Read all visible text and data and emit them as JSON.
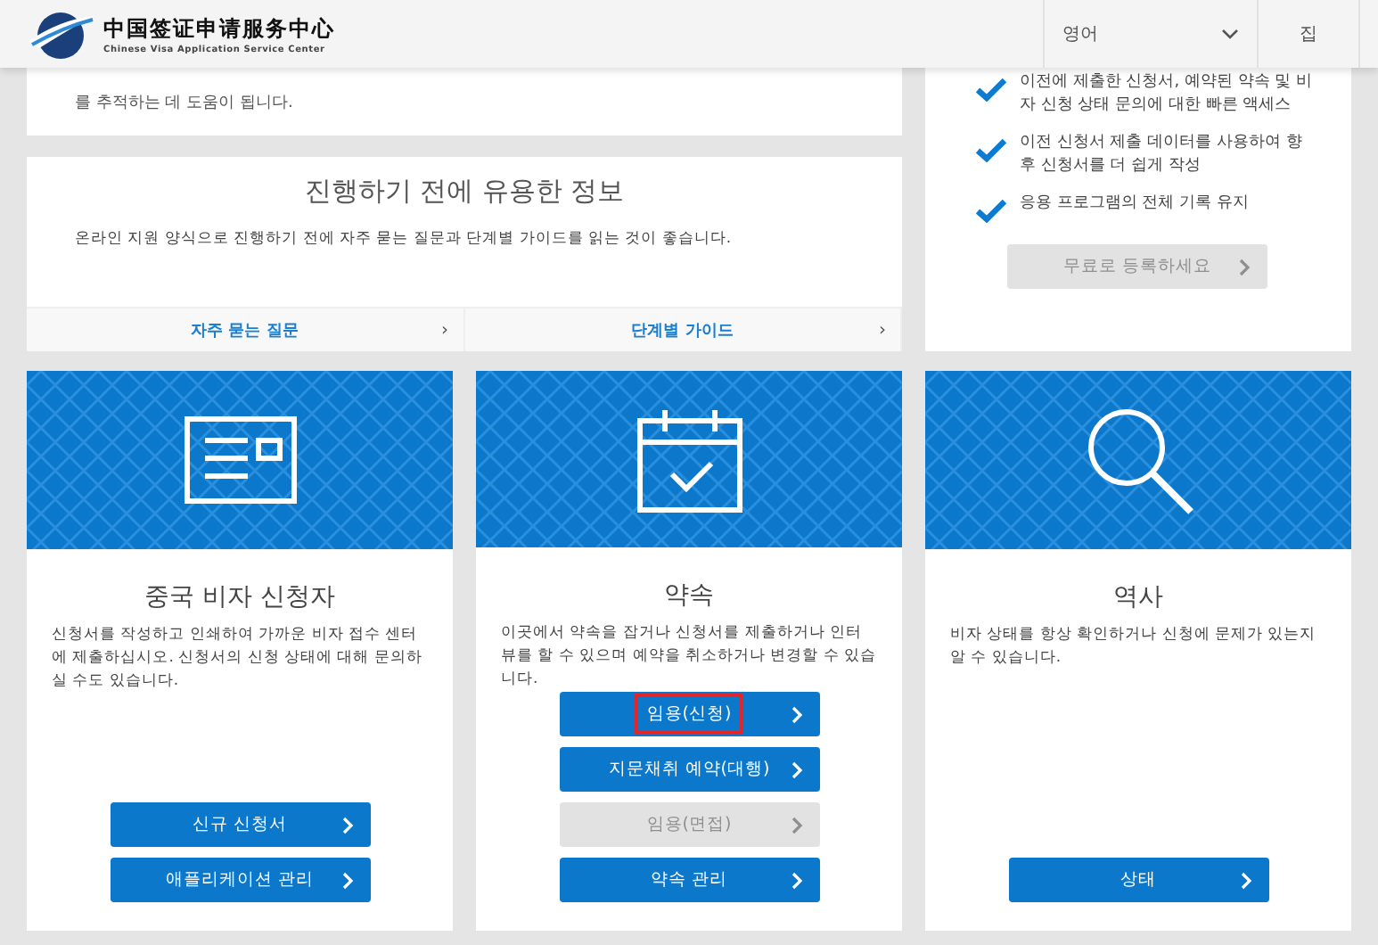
{
  "header": {
    "logo_title": "中国签证申请服务中心",
    "logo_subtitle": "Chinese Visa Application Service Center",
    "language": "영어",
    "home": "집"
  },
  "top_card": {
    "text": "를 추적하는 데 도움이 됩니다."
  },
  "info": {
    "title": "진행하기 전에 유용한 정보",
    "text": "온라인 지원 양식으로 진행하기 전에 자주 묻는 질문과 단계별 가이드를 읽는 것이 좋습니다.",
    "links": [
      "자주 묻는 질문",
      "단계별 가이드"
    ],
    "arrow": "›"
  },
  "register": {
    "benefits": [
      "이전에 제출한 신청서, 예약된 약속 및 비자 신청 상태 문의에 대한 빠른 액세스",
      "이전 신청서 제출 데이터를 사용하여 향후 신청서를 더 쉽게 작성",
      "응용 프로그램의 전체 기록 유지"
    ],
    "button": {
      "label": "무료로 등록하세요",
      "disabled": true
    }
  },
  "cards": [
    {
      "kind": "form",
      "title": "중국 비자 신청자",
      "text": "신청서를 작성하고 인쇄하여 가까운 비자 접수 센터에 제출하십시오. 신청서의 신청 상태에 대해 문의하실 수도 있습니다.",
      "buttons": [
        {
          "label": "신규 신청서",
          "disabled": false,
          "highlighted": false
        },
        {
          "label": "애플리케이션 관리",
          "disabled": false,
          "highlighted": false
        }
      ]
    },
    {
      "kind": "calendar",
      "title": "약속",
      "text": "이곳에서 약속을 잡거나 신청서를 제출하거나 인터뷰를 할 수 있으며 예약을 취소하거나 변경할 수 있습니다.",
      "buttons": [
        {
          "label": "임용(신청)",
          "disabled": false,
          "highlighted": true
        },
        {
          "label": "지문채취 예약(대행)",
          "disabled": false,
          "highlighted": false
        },
        {
          "label": "임용(면접)",
          "disabled": true,
          "highlighted": false
        },
        {
          "label": "약속 관리",
          "disabled": false,
          "highlighted": false
        }
      ]
    },
    {
      "kind": "search",
      "title": "역사",
      "text": "비자 상태를 항상 확인하거나 신청에 문제가 있는지 알 수 있습니다.",
      "buttons": [
        {
          "label": "상태",
          "disabled": false,
          "highlighted": false
        }
      ]
    }
  ]
}
